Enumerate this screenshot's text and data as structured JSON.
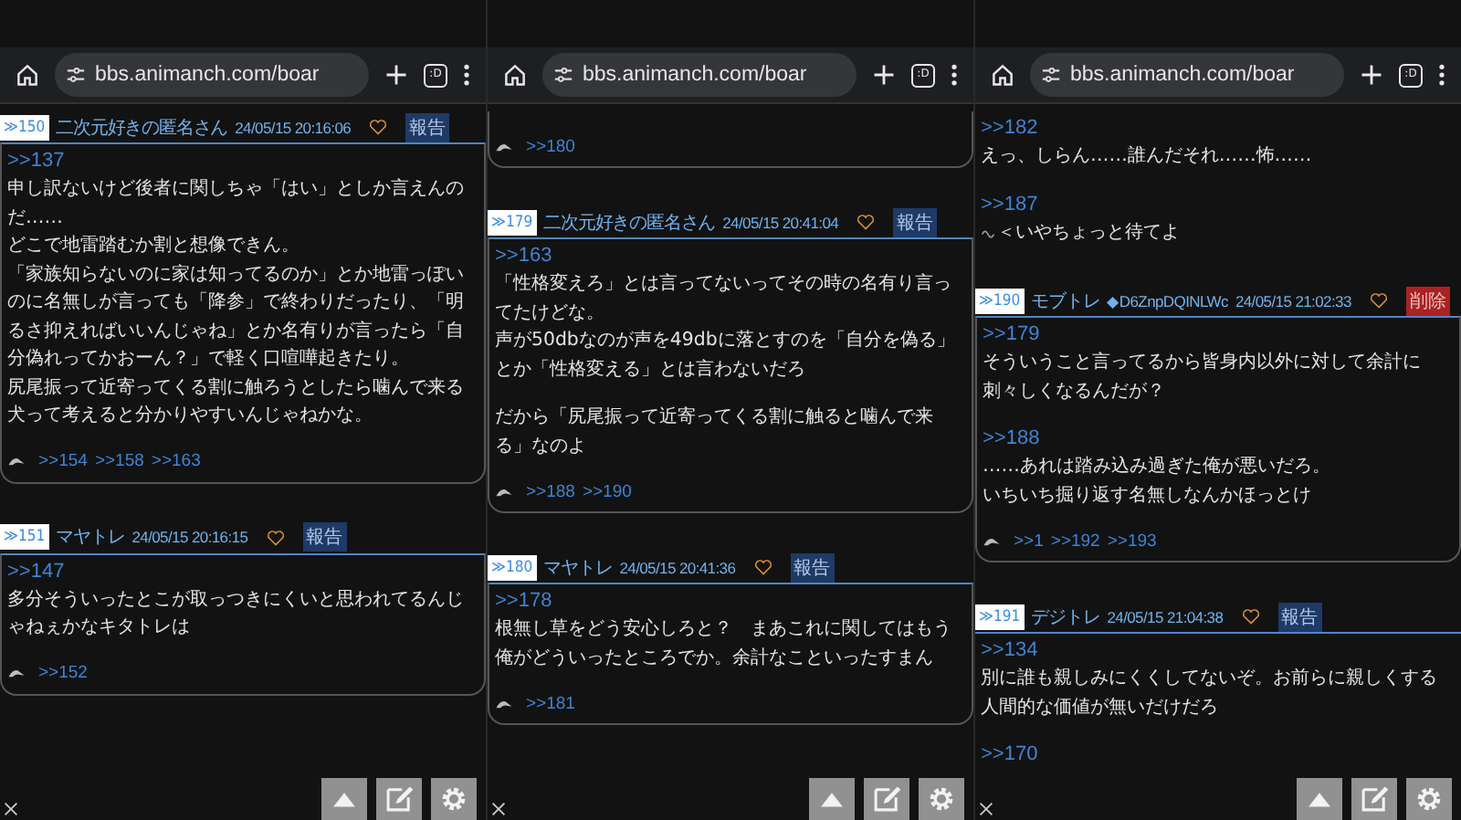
{
  "panels": [
    {
      "url": "bbs.animanch.com/boar",
      "tab_count": ":D",
      "posts": [
        {
          "header": {
            "number": "≫150",
            "name": "二次元好きの匿名さん",
            "date": "24/05/15 20:16:06",
            "action": {
              "kind": "report",
              "label": "報告"
            }
          },
          "segments": [
            {
              "ref": ">>137",
              "lines": [
                "申し訳ないけど後者に関しちゃ「はい」としか言えんの",
                "だ……",
                "どこで地雷踏むか割と想像できん。",
                "「家族知らないのに家は知ってるのか」とか地雷っぽい",
                "のに名無しが言っても「降参」で終わりだったり、「明",
                "るさ抑えればいいんじゃね」とか名有りが言ったら「自",
                "分偽れってかおーん？」で軽く口喧嘩起きたり。",
                "尻尾振って近寄ってくる割に触ろうとしたら噛んで来る",
                "犬って考えると分かりやすいんじゃねかな。"
              ]
            }
          ],
          "replies": [
            ">>154",
            ">>158",
            ">>163"
          ]
        },
        {
          "header": {
            "number": "≫151",
            "name": "マヤトレ",
            "date": "24/05/15 20:16:15",
            "action": {
              "kind": "report",
              "label": "報告"
            }
          },
          "segments": [
            {
              "ref": ">>147",
              "lines": [
                "多分そういったとこが取っつきにくいと思われてるんじ",
                "ゃねぇかなキタトレは"
              ]
            }
          ],
          "replies": [
            ">>152"
          ]
        }
      ]
    },
    {
      "url": "bbs.animanch.com/boar",
      "tab_count": ":D",
      "posts": [
        {
          "replies": [
            ">>180"
          ]
        },
        {
          "header": {
            "number": "≫179",
            "name": "二次元好きの匿名さん",
            "date": "24/05/15 20:41:04",
            "action": {
              "kind": "report",
              "label": "報告"
            }
          },
          "segments": [
            {
              "ref": ">>163",
              "lines": [
                "「性格変えろ」とは言ってないってその時の名有り言っ",
                "てたけどな。",
                "声が50dbなのが声を49dbに落とすのを「自分を偽る」",
                "とか「性格変える」とは言わないだろ"
              ]
            },
            {
              "lines": [
                "だから「尻尾振って近寄ってくる割に触ると噛んで来",
                "る」なのよ"
              ]
            }
          ],
          "replies": [
            ">>188",
            ">>190"
          ]
        },
        {
          "header": {
            "number": "≫180",
            "name": "マヤトレ",
            "date": "24/05/15 20:41:36",
            "action": {
              "kind": "report",
              "label": "報告"
            }
          },
          "segments": [
            {
              "ref": ">>178",
              "lines": [
                "根無し草をどう安心しろと？　まあこれに関してはもう",
                "俺がどういったところでか。余計なこといったすまん"
              ]
            }
          ],
          "replies": [
            ">>181"
          ]
        }
      ]
    },
    {
      "url": "bbs.animanch.com/boar",
      "tab_count": ":D",
      "posts": [
        {
          "segments": [
            {
              "ref": ">>182",
              "lines": [
                "えっ、しらん……誰んだそれ……怖……"
              ]
            },
            {
              "ref": ">>187",
              "emoji": true,
              "lines": [
                "＜いやちょっと待てよ"
              ]
            }
          ]
        },
        {
          "header": {
            "number": "≫190",
            "name": "モブトレ",
            "trip": "◆D6ZnpDQINLWc",
            "date": "24/05/15 21:02:33",
            "action": {
              "kind": "delete",
              "label": "削除"
            }
          },
          "segments": [
            {
              "ref": ">>179",
              "lines": [
                "そういうこと言ってるから皆身内以外に対して余計に",
                "刺々しくなるんだが？"
              ]
            },
            {
              "ref": ">>188",
              "lines": [
                "……あれは踏み込み過ぎた俺が悪いだろ。",
                "いちいち掘り返す名無しなんかほっとけ"
              ]
            }
          ],
          "replies": [
            ">>1",
            ">>192",
            ">>193"
          ]
        },
        {
          "header": {
            "number": "≫191",
            "name": "デジトレ",
            "date": "24/05/15 21:04:38",
            "action": {
              "kind": "report",
              "label": "報告"
            }
          },
          "segments": [
            {
              "ref": ">>134",
              "lines": [
                "別に誰も親しみにくくしてないぞ。お前らに親しくする",
                "人間的な価値が無いだけだろ"
              ]
            },
            {
              "ref": ">>170"
            }
          ]
        }
      ]
    }
  ]
}
